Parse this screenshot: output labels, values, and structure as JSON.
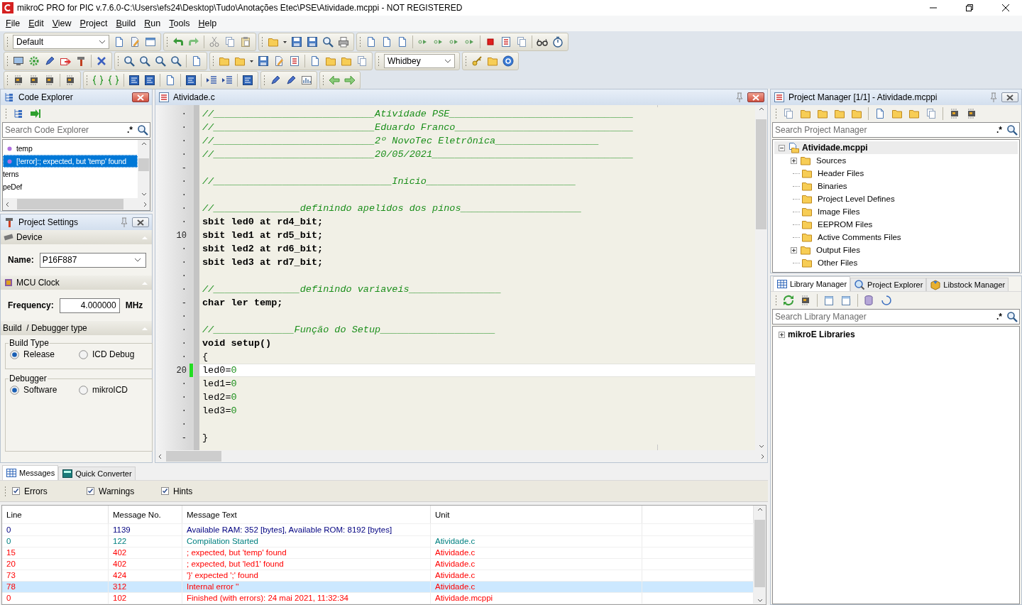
{
  "window": {
    "title": "mikroC PRO for PIC v.7.6.0-C:\\Users\\efs24\\Desktop\\Tudo\\Anotações Etec\\PSE\\Atividade.mcppi - NOT REGISTERED"
  },
  "menu": [
    "File",
    "Edit",
    "View",
    "Project",
    "Build",
    "Run",
    "Tools",
    "Help"
  ],
  "toolbar": {
    "scheme": "Default",
    "theme": "Whidbey"
  },
  "code_explorer": {
    "title": "Code Explorer",
    "search": {
      "placeholder": "Search Code Explorer",
      "regex": ".*"
    },
    "items": [
      {
        "label": "temp",
        "kind": "symbol",
        "selected": false
      },
      {
        "label": "[!error]:; expected, but 'temp' found",
        "kind": "symbol",
        "selected": true
      },
      {
        "label": "terns",
        "kind": "partial",
        "selected": false
      },
      {
        "label": "peDef",
        "kind": "partial",
        "selected": false
      }
    ]
  },
  "project_settings": {
    "title": "Project Settings",
    "device": {
      "header": "Device",
      "label": "Name:",
      "value": "P16F887"
    },
    "clock": {
      "header": "MCU Clock",
      "label": "Frequency:",
      "value": "4.000000",
      "unit": "MHz"
    },
    "build": {
      "header": "Build  / Debugger type",
      "groups": [
        {
          "title": "Build Type",
          "options": [
            {
              "label": "Release",
              "selected": true
            },
            {
              "label": "ICD Debug",
              "selected": false
            }
          ]
        },
        {
          "title": "Debugger",
          "options": [
            {
              "label": "Software",
              "selected": true
            },
            {
              "label": "mikroICD",
              "selected": false
            }
          ]
        }
      ]
    }
  },
  "editor": {
    "tab": "Atividade.c",
    "lines": [
      {
        "gutter": "·",
        "current": false,
        "modified": false,
        "tokens": [
          {
            "kind": "comment",
            "text": "//____________________________Atividade PSE________________________________"
          }
        ]
      },
      {
        "gutter": "·",
        "current": false,
        "modified": false,
        "tokens": [
          {
            "kind": "comment",
            "text": "//____________________________Eduardo Franco_______________________________"
          }
        ]
      },
      {
        "gutter": "·",
        "current": false,
        "modified": false,
        "tokens": [
          {
            "kind": "comment",
            "text": "//____________________________2º NovoTec Eletrônica__________________"
          }
        ]
      },
      {
        "gutter": "·",
        "current": false,
        "modified": false,
        "tokens": [
          {
            "kind": "comment",
            "text": "//____________________________20/05/2021___________________________________"
          }
        ]
      },
      {
        "gutter": "-",
        "current": false,
        "modified": false
      },
      {
        "gutter": "·",
        "current": false,
        "modified": false,
        "tokens": [
          {
            "kind": "comment",
            "text": "//_______________________________Inicio__________________________"
          }
        ]
      },
      {
        "gutter": "·",
        "current": false,
        "modified": false
      },
      {
        "gutter": "·",
        "current": false,
        "modified": false,
        "tokens": [
          {
            "kind": "comment",
            "text": "//_______________definindo apelidos dos pinos_____________________"
          }
        ]
      },
      {
        "gutter": "·",
        "current": false,
        "modified": false,
        "tokens": [
          {
            "kind": "keyword",
            "text": "sbit led0 at rd4_bit;"
          }
        ]
      },
      {
        "gutter": "10",
        "current": false,
        "modified": false,
        "tokens": [
          {
            "kind": "keyword",
            "text": "sbit led1 at rd5_bit;"
          }
        ]
      },
      {
        "gutter": "·",
        "current": false,
        "modified": false,
        "tokens": [
          {
            "kind": "keyword",
            "text": "sbit led2 at rd6_bit;"
          }
        ]
      },
      {
        "gutter": "·",
        "current": false,
        "modified": false,
        "tokens": [
          {
            "kind": "keyword",
            "text": "sbit led3 at rd7_bit;"
          }
        ]
      },
      {
        "gutter": "·",
        "current": false,
        "modified": false
      },
      {
        "gutter": "·",
        "current": false,
        "modified": false,
        "tokens": [
          {
            "kind": "comment",
            "text": "//_______________definindo variaveis________________"
          }
        ]
      },
      {
        "gutter": "-",
        "current": false,
        "modified": false,
        "tokens": [
          {
            "kind": "keyword",
            "text": "char ler temp;"
          }
        ]
      },
      {
        "gutter": "·",
        "current": false,
        "modified": false
      },
      {
        "gutter": "·",
        "current": false,
        "modified": false,
        "tokens": [
          {
            "kind": "comment",
            "text": "//______________Função do Setup____________________"
          }
        ]
      },
      {
        "gutter": "·",
        "current": false,
        "modified": false,
        "tokens": [
          {
            "kind": "keyword",
            "text": "void setup()"
          }
        ]
      },
      {
        "gutter": "·",
        "current": false,
        "modified": false,
        "tokens": [
          {
            "kind": "plain",
            "text": "{"
          }
        ]
      },
      {
        "gutter": "20",
        "current": true,
        "modified": true,
        "tokens": [
          {
            "kind": "plain",
            "text": "led0="
          },
          {
            "kind": "number",
            "text": "0"
          }
        ]
      },
      {
        "gutter": "·",
        "current": false,
        "modified": false,
        "tokens": [
          {
            "kind": "plain",
            "text": "led1="
          },
          {
            "kind": "number",
            "text": "0"
          }
        ]
      },
      {
        "gutter": "·",
        "current": false,
        "modified": false,
        "tokens": [
          {
            "kind": "plain",
            "text": "led2="
          },
          {
            "kind": "number",
            "text": "0"
          }
        ]
      },
      {
        "gutter": "·",
        "current": false,
        "modified": false,
        "tokens": [
          {
            "kind": "plain",
            "text": "led3="
          },
          {
            "kind": "number",
            "text": "0"
          }
        ]
      },
      {
        "gutter": "·",
        "current": false,
        "modified": false
      },
      {
        "gutter": "-",
        "current": false,
        "modified": false,
        "tokens": [
          {
            "kind": "plain",
            "text": "}"
          }
        ]
      }
    ]
  },
  "project_manager": {
    "title": "Project Manager [1/1] - Atividade.mcppi",
    "search": {
      "placeholder": "Search Project Manager",
      "regex": ".*"
    },
    "tree": {
      "label": "Atividade.mcppi",
      "expanded": true,
      "children": [
        {
          "label": "Sources",
          "expandable": true
        },
        {
          "label": "Header Files",
          "expandable": false
        },
        {
          "label": "Binaries",
          "expandable": false
        },
        {
          "label": "Project Level Defines",
          "expandable": false
        },
        {
          "label": "Image Files",
          "expandable": false
        },
        {
          "label": "EEPROM Files",
          "expandable": false
        },
        {
          "label": "Active Comments Files",
          "expandable": false
        },
        {
          "label": "Output Files",
          "expandable": true
        },
        {
          "label": "Other Files",
          "expandable": false
        }
      ]
    }
  },
  "library": {
    "tabs": [
      {
        "label": "Library Manager",
        "selected": true
      },
      {
        "label": "Project Explorer",
        "selected": false
      },
      {
        "label": "Libstock Manager",
        "selected": false
      }
    ],
    "search": {
      "placeholder": "Search Library Manager",
      "regex": ".*"
    },
    "tree": {
      "label": "mikroE Libraries",
      "expanded": false
    }
  },
  "messages": {
    "tabs": [
      {
        "label": "Messages",
        "selected": true
      },
      {
        "label": "Quick Converter",
        "selected": false
      }
    ],
    "filters": [
      {
        "label": "Errors",
        "checked": true
      },
      {
        "label": "Warnings",
        "checked": true
      },
      {
        "label": "Hints",
        "checked": true
      }
    ],
    "columns": [
      "Line",
      "Message No.",
      "Message Text",
      "Unit"
    ],
    "rows": [
      {
        "line": "0",
        "number": "1139",
        "text": "Available RAM: 352 [bytes], Available ROM: 8192 [bytes]",
        "kind": "info",
        "selected": false
      },
      {
        "line": "0",
        "number": "122",
        "text": "Compilation Started",
        "unit": "Atividade.c",
        "kind": "status",
        "selected": false
      },
      {
        "line": "15",
        "number": "402",
        "text": "; expected, but 'temp' found",
        "unit": "Atividade.c",
        "kind": "error",
        "selected": false
      },
      {
        "line": "20",
        "number": "402",
        "text": "; expected, but 'led1' found",
        "unit": "Atividade.c",
        "kind": "error",
        "selected": false
      },
      {
        "line": "73",
        "number": "424",
        "text": "'}' expected ';' found",
        "unit": "Atividade.c",
        "kind": "error",
        "selected": false
      },
      {
        "line": "78",
        "number": "312",
        "text": "Internal error ''",
        "unit": "Atividade.c",
        "kind": "error",
        "selected": true
      },
      {
        "line": "0",
        "number": "102",
        "text": "Finished (with errors): 24 mai 2021, 11:32:34",
        "unit": "Atividade.mcppi",
        "kind": "error",
        "selected": false
      }
    ]
  }
}
